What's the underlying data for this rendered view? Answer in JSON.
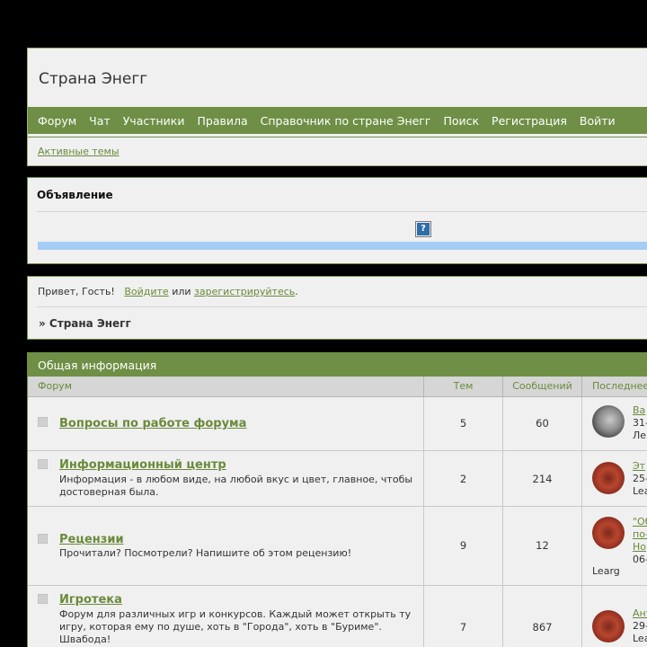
{
  "header": {
    "title": "Страна Энегг",
    "nav": [
      "Форум",
      "Чат",
      "Участники",
      "Правила",
      "Справочник по стране Энегг",
      "Поиск",
      "Регистрация",
      "Войти"
    ],
    "subnav_link": "Активные темы"
  },
  "announcement": {
    "title": "Объявление",
    "icon": "help-icon"
  },
  "greeting": {
    "hello": "Привет, Гость!",
    "login": "Войдите",
    "or": "или",
    "register": "зарегистрируйтесь",
    "dot": ".",
    "breadcrumb": "» Страна Энегг"
  },
  "forum_table": {
    "category": "Общая информация",
    "columns": [
      "Форум",
      "Тем",
      "Сообщений",
      "Последнее"
    ],
    "rows": [
      {
        "name": "Вопросы по работе форума",
        "desc": "",
        "topics": "5",
        "posts": "60",
        "last": [
          "Ва",
          "31-",
          "Лe"
        ]
      },
      {
        "name": "Информационный центр",
        "desc": "Информация - в любом виде, на любой вкус и цвет, главное, чтобы достоверная была.",
        "topics": "2",
        "posts": "214",
        "last": [
          "Эт",
          "25-",
          "Lea"
        ]
      },
      {
        "name": "Рецензии",
        "desc": "Прочитали? Посмотрели? Напишите об этом рецензию!",
        "topics": "9",
        "posts": "12",
        "last": [
          "\"Об",
          "по-",
          "Но",
          "06-",
          "Learg"
        ]
      },
      {
        "name": "Игротека",
        "desc": "Форум для различных игр и конкурсов. Каждый может открыть ту игру, которая ему по душе, хоть в \"Города\", хоть в \"Буриме\". Швабода!",
        "topics": "7",
        "posts": "867",
        "last": [
          "Ант",
          "29-",
          "Lea"
        ]
      }
    ]
  }
}
